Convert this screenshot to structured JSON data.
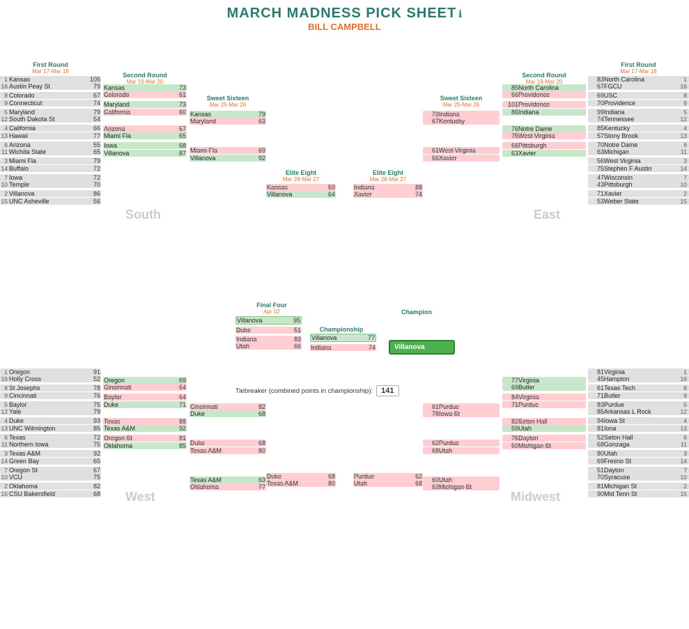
{
  "header": {
    "title": "MARCH MADNESS PICK SHEET",
    "subtitle": "BILL CAMPBELL",
    "info_icon": "ℹ"
  },
  "tiebreaker": {
    "label": "Tiebreaker (combined points in championship):",
    "value": "141"
  }
}
